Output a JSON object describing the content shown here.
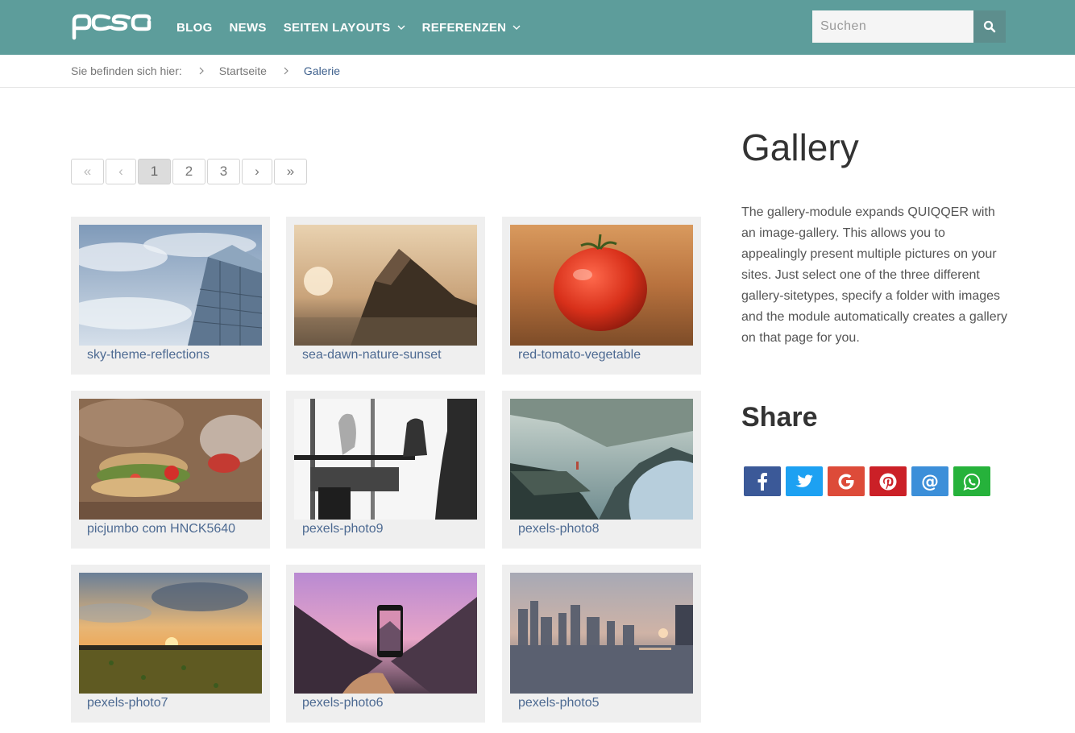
{
  "header": {
    "logo_text": "pcsg",
    "nav": [
      {
        "label": "BLOG"
      },
      {
        "label": "NEWS"
      },
      {
        "label": "SEITEN LAYOUTS"
      },
      {
        "label": "REFERENZEN"
      }
    ],
    "search_placeholder": "Suchen",
    "search_icon": "search-icon"
  },
  "breadcrumb": {
    "label": "Sie befinden sich hier:",
    "items": [
      "Startseite",
      "Galerie"
    ]
  },
  "pagination": {
    "first": "«",
    "prev": "‹",
    "pages": [
      "1",
      "2",
      "3"
    ],
    "current": "1",
    "next": "›",
    "last": "»"
  },
  "gallery": {
    "items": [
      {
        "caption": "sky-theme-reflections"
      },
      {
        "caption": "sea-dawn-nature-sunset"
      },
      {
        "caption": "red-tomato-vegetable"
      },
      {
        "caption": "picjumbo com HNCK5640"
      },
      {
        "caption": "pexels-photo9"
      },
      {
        "caption": "pexels-photo8"
      },
      {
        "caption": "pexels-photo7"
      },
      {
        "caption": "pexels-photo6"
      },
      {
        "caption": "pexels-photo5"
      }
    ]
  },
  "sidebar": {
    "title": "Gallery",
    "description": "The gallery-module expands QUIQQER with an image-gallery. This allows you to appealingly present multiple pictures on your sites. Just select one of the three different gallery-sitetypes, specify a folder with images and the module automatically creates a gallery on that page for you.",
    "share_title": "Share",
    "share_buttons": [
      {
        "icon": "facebook-icon",
        "color": "#3b5998"
      },
      {
        "icon": "twitter-icon",
        "color": "#1da1f2"
      },
      {
        "icon": "google-icon",
        "color": "#dd4b39"
      },
      {
        "icon": "pinterest-icon",
        "color": "#cb2027"
      },
      {
        "icon": "email-icon",
        "color": "#3c8fd9"
      },
      {
        "icon": "whatsapp-icon",
        "color": "#26b23b"
      }
    ]
  },
  "colors": {
    "header_bg": "#5d9d9b",
    "link": "#4d6a92"
  }
}
